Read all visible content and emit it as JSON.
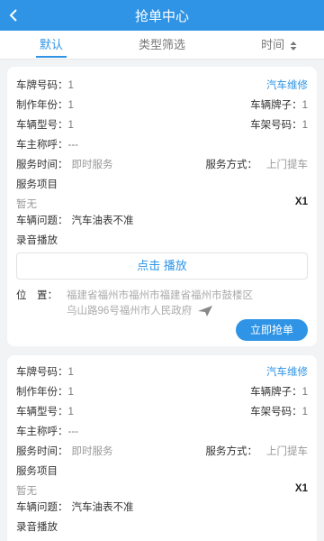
{
  "header": {
    "title": "抢单中心",
    "back_icon": "chevron-left-icon"
  },
  "tabs": [
    {
      "label": "默认",
      "active": true
    },
    {
      "label": "类型筛选",
      "active": false
    },
    {
      "label": "时间",
      "active": false,
      "icon": "sort-icon"
    }
  ],
  "orders": [
    {
      "plate_label": "车牌号码：",
      "plate_value": "1",
      "type": "汽车维修",
      "year_label": "制作年份：",
      "year_value": "1",
      "brand_label": "车辆牌子：",
      "brand_value": "1",
      "model_label": "车辆型号：",
      "model_value": "1",
      "frame_label": "车架号码：",
      "frame_value": "1",
      "owner_label": "车主称呼：",
      "owner_value": "---",
      "time_label": "服务时间：",
      "time_value": "即时服务",
      "method_label": "服务方式：",
      "method_value": "上门提车",
      "items_label": "服务项目",
      "items_value": "暂无",
      "items_qty": "X1",
      "problem_label": "车辆问题：",
      "problem_value": "汽车油表不准",
      "audio_label": "录音播放",
      "play_label": "点击 播放",
      "location_label": "位　置：",
      "location_value": "福建省福州市福州市福建省福州市鼓楼区乌山路96号福州市人民政府",
      "location_icon": "send-icon",
      "grab_label": "立即抢单"
    },
    {
      "plate_label": "车牌号码：",
      "plate_value": "1",
      "type": "汽车维修",
      "year_label": "制作年份：",
      "year_value": "1",
      "brand_label": "车辆牌子：",
      "brand_value": "1",
      "model_label": "车辆型号：",
      "model_value": "1",
      "frame_label": "车架号码：",
      "frame_value": "1",
      "owner_label": "车主称呼：",
      "owner_value": "---",
      "time_label": "服务时间：",
      "time_value": "即时服务",
      "method_label": "服务方式：",
      "method_value": "上门提车",
      "items_label": "服务项目",
      "items_value": "暂无",
      "items_qty": "X1",
      "problem_label": "车辆问题：",
      "problem_value": "汽车油表不准",
      "audio_label": "录音播放"
    }
  ],
  "colors": {
    "primary": "#2f94e5",
    "background": "#f2f3f5"
  }
}
